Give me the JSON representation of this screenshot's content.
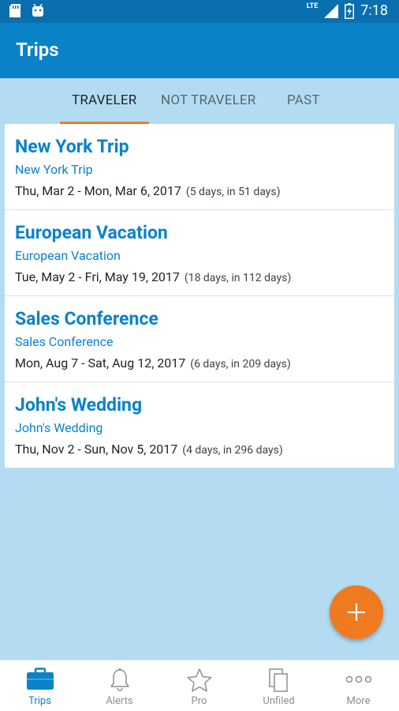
{
  "status_bar": {
    "network": "LTE",
    "time": "7:18"
  },
  "app_bar": {
    "title": "Trips"
  },
  "tabs": [
    {
      "label": "TRAVELER",
      "active": true
    },
    {
      "label": "NOT TRAVELER",
      "active": false
    },
    {
      "label": "PAST",
      "active": false
    }
  ],
  "trips": [
    {
      "name": "New York Trip",
      "subtitle": "New York Trip",
      "dates": "Thu, Mar 2 - Mon, Mar 6, 2017",
      "relative": "(5 days, in 51 days)"
    },
    {
      "name": "European Vacation",
      "subtitle": "European Vacation",
      "dates": "Tue, May 2 - Fri, May 19, 2017",
      "relative": "(18 days, in 112 days)"
    },
    {
      "name": "Sales Conference",
      "subtitle": "Sales Conference",
      "dates": "Mon, Aug 7 - Sat, Aug 12, 2017",
      "relative": "(6 days, in 209 days)"
    },
    {
      "name": "John's Wedding",
      "subtitle": "John's Wedding",
      "dates": "Thu, Nov 2 - Sun, Nov 5, 2017",
      "relative": "(4 days, in 296 days)"
    }
  ],
  "fab": {
    "icon": "plus-icon"
  },
  "bottom_nav": [
    {
      "label": "Trips",
      "icon": "briefcase-icon",
      "active": true
    },
    {
      "label": "Alerts",
      "icon": "bell-icon",
      "active": false
    },
    {
      "label": "Pro",
      "icon": "star-icon",
      "active": false
    },
    {
      "label": "Unfiled",
      "icon": "documents-icon",
      "active": false
    },
    {
      "label": "More",
      "icon": "more-dots-icon",
      "active": false
    }
  ],
  "colors": {
    "primary": "#0a82c8",
    "status_bar": "#0a6fae",
    "accent": "#f07a1f",
    "background": "#b3dcf2"
  }
}
